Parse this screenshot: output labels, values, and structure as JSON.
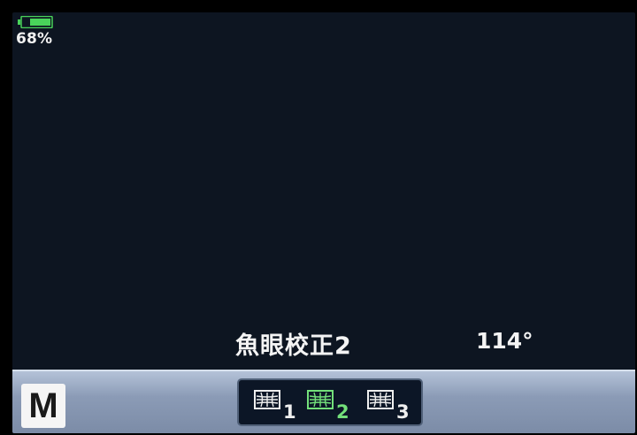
{
  "status": {
    "battery_percent": "68%",
    "battery_level": 0.68,
    "battery_color": "#49d35a"
  },
  "info": {
    "mode_name": "魚眼校正2",
    "angle": "114°"
  },
  "bottom_bar": {
    "shooting_mode": "M",
    "options": [
      {
        "label": "1",
        "icon": "fisheye-correction-1-icon",
        "selected": false
      },
      {
        "label": "2",
        "icon": "fisheye-correction-2-icon",
        "selected": true
      },
      {
        "label": "3",
        "icon": "fisheye-correction-3-icon",
        "selected": false
      }
    ],
    "selected_color": "#73e07a"
  }
}
